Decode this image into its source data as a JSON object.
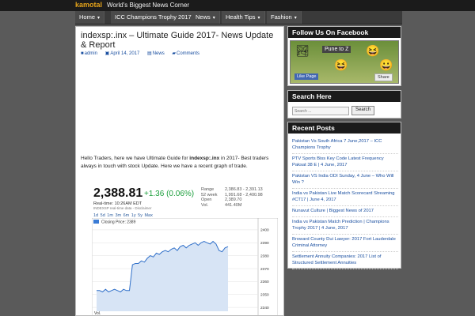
{
  "header": {
    "logo": "kamotal",
    "tagline": "World's Biggest News Corner"
  },
  "nav": [
    {
      "label": "Home",
      "dropdown": true
    },
    {
      "label": "ICC Champions Trophy 2017",
      "dropdown": false
    },
    {
      "label": "News",
      "dropdown": true
    },
    {
      "label": "Health Tips",
      "dropdown": true
    },
    {
      "label": "Fashion",
      "dropdown": true
    }
  ],
  "article": {
    "title": "indexsp:.inx – Ultimate Guide 2017- News Update & Report",
    "author": "admin",
    "date": "April 14, 2017",
    "category": "News",
    "comments": "Comments",
    "para_pre": "Hello Traders, here we have Ultimate Guide for ",
    "para_bold": "indexsp:.inx",
    "para_post": " in 2017- Best traders always in touch with stock Update. Here we have a recent graph of trade."
  },
  "stock": {
    "price": "2,388.81",
    "change": "+1.36 (0.06%)",
    "realtime": "Real-time:      10:26AM EDT",
    "source": "INDEXSP real-time data - Disclaimer",
    "stats": [
      {
        "label": "Range",
        "value": "2,386.83 - 2,391.13"
      },
      {
        "label": "52 week",
        "value": "1,991.68 - 2,400.98"
      },
      {
        "label": "Open",
        "value": "2,389.70"
      },
      {
        "label": "Vol.",
        "value": "441.40M"
      }
    ],
    "ranges": "1d 5d 1m 3m 6m 1y 5y Max"
  },
  "chart_data": {
    "type": "line",
    "legend": "Closing Price: 2389",
    "y_ticks": [
      2400,
      2390,
      2380,
      2370,
      2360,
      2350,
      2340
    ],
    "ylim": [
      2337,
      2403
    ],
    "series": [
      {
        "name": "Closing Price",
        "values": [
          2353,
          2353,
          2352,
          2354,
          2352,
          2353,
          2354,
          2353,
          2352,
          2354,
          2353,
          2353,
          2373,
          2374,
          2374,
          2376,
          2375,
          2378,
          2380,
          2379,
          2382,
          2381,
          2383,
          2384,
          2383,
          2385,
          2386,
          2384,
          2387,
          2388,
          2386,
          2388,
          2389,
          2390,
          2388,
          2390,
          2391,
          2390,
          2389,
          2391,
          2389,
          2384,
          2383,
          2386,
          2387
        ]
      }
    ],
    "x_label_bottom": "Vol."
  },
  "sidebar": {
    "facebook_title": "Follow Us On Facebook",
    "facebook_page": "Pune to Z",
    "like_label": "Like Page",
    "share_label": "Share",
    "search_title": "Search Here",
    "search_placeholder": "Search ...",
    "search_button": "Search",
    "recent_title": "Recent Posts",
    "recent_posts": [
      "Pakistan Vs South Africa 7 June,2017 – ICC Champions Trophy",
      "PTV Sports Biss Key Code Latest Frequency Paksat 38 E | 4 June, 2017",
      "Pakistan VS India ODI Sunday, 4 June – Who Will Win ?",
      "India vs Pakistan Live Match Scorecard Streaming #CT17 | June 4, 2017",
      "Nunavut Culture | Biggest News of 2017",
      "India vs Pakistan Match Prediction | Champions Trophy 2017 | 4 June, 2017",
      "Broward County Dui Lawyer: 2017 Fort Lauderdale Criminal Attorney",
      "Settlement Annuity Companies: 2017 List of Structured Settlement Annuities"
    ]
  }
}
